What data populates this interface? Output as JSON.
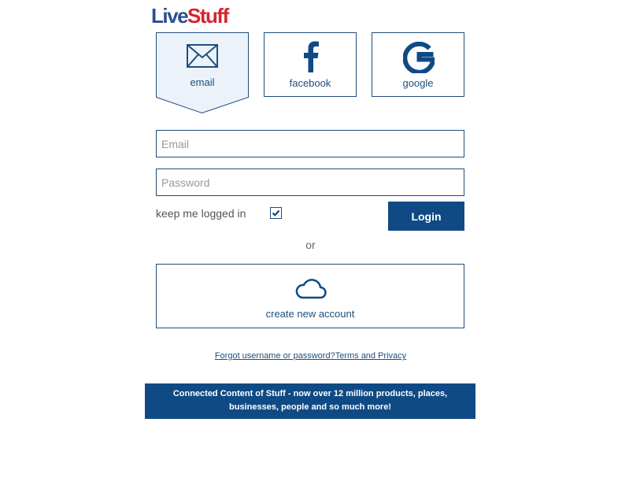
{
  "logo": {
    "part1": "Live",
    "part2": "Stuff"
  },
  "tabs": [
    {
      "label": "email",
      "icon": "envelope-icon"
    },
    {
      "label": "facebook",
      "icon": "facebook-icon"
    },
    {
      "label": "google",
      "icon": "google-icon"
    }
  ],
  "form": {
    "email_placeholder": "Email",
    "password_placeholder": "Password",
    "keep_logged_in_label": "keep me logged in",
    "keep_logged_in_checked": true,
    "login_label": "Login"
  },
  "divider_text": "or",
  "create_account": {
    "label": "create new account",
    "icon": "cloud-icon"
  },
  "links": {
    "forgot": "Forgot username or password?",
    "terms": "Terms and Privacy"
  },
  "banner": "Connected Content of Stuff - now over 12 million products, places, businesses, people and so much more!",
  "colors": {
    "primary": "#0f4a85",
    "border": "#1f4e7a",
    "logo_blue": "#2c4f8f",
    "logo_red": "#d9232e",
    "email_tab_bg": "#ebf2fa"
  }
}
